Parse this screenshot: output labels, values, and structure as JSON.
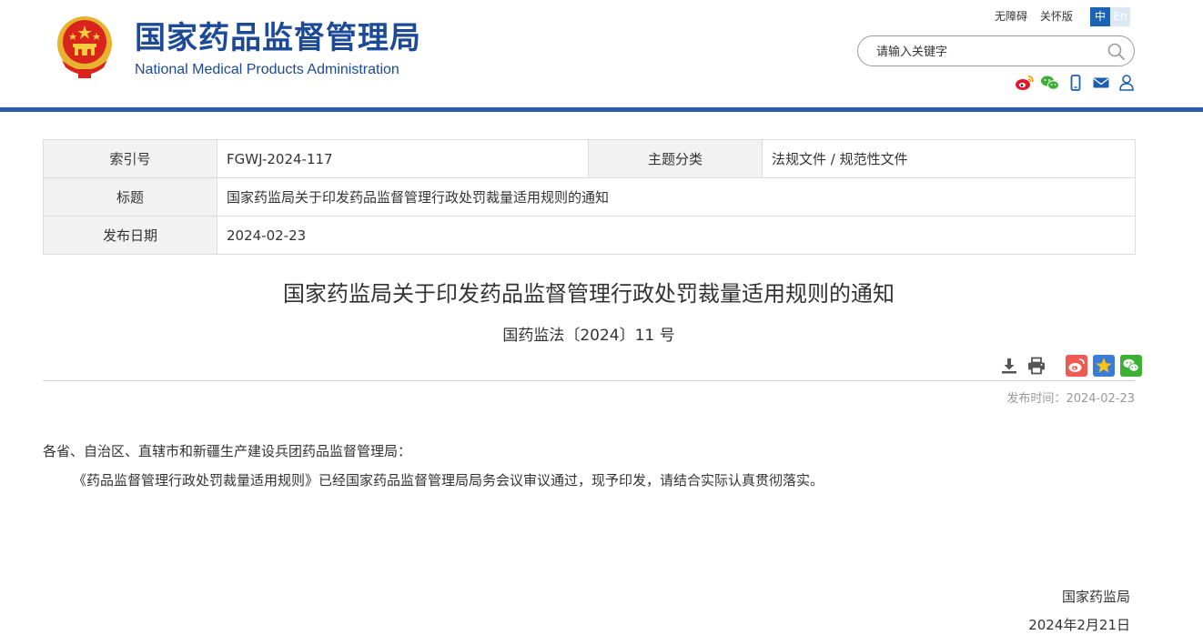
{
  "header": {
    "title_cn": "国家药品监督管理局",
    "title_en": "National Medical Products Administration",
    "accessibility": "无障碍",
    "elderly_mode": "关怀版",
    "lang_zh": "中",
    "lang_en": "En",
    "search_placeholder": "请输入关键字",
    "share_icons": [
      "weibo-icon",
      "wechat-icon",
      "mobile-icon",
      "mail-icon",
      "user-icon"
    ]
  },
  "info": {
    "index_label": "索引号",
    "index_value": "FGWJ-2024-117",
    "category_label": "主题分类",
    "category_value": "法规文件 / 规范性文件",
    "title_label": "标题",
    "title_value": "国家药监局关于印发药品监督管理行政处罚裁量适用规则的通知",
    "date_label": "发布日期",
    "date_value": "2024-02-23"
  },
  "article": {
    "title": "国家药监局关于印发药品监督管理行政处罚裁量适用规则的通知",
    "doc_number": "国药监法〔2024〕11 号",
    "publish_label": "发布时间：",
    "publish_time": "2024-02-23",
    "salutation": "各省、自治区、直辖市和新疆生产建设兵团药品监督管理局：",
    "body": "《药品监督管理行政处罚裁量适用规则》已经国家药品监督管理局局务会议审议通过，现予印发，请结合实际认真贯彻落实。",
    "signature_org": "国家药监局",
    "signature_date": "2024年2月21日"
  },
  "colors": {
    "brand_blue": "#1d4a96",
    "bar_blue": "#2a5ea9",
    "weibo_red": "#e6162d",
    "wechat_green": "#3cb034"
  }
}
